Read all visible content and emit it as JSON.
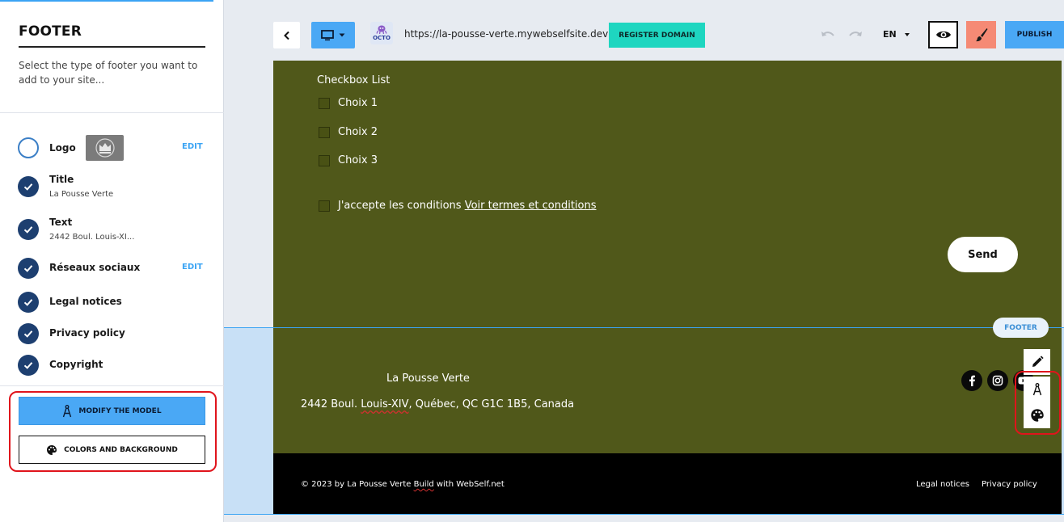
{
  "panel": {
    "title": "FOOTER",
    "description": "Select the type of footer you want to add to your site...",
    "options": [
      {
        "label": "Logo",
        "sub": "",
        "checked": false,
        "edit": "EDIT"
      },
      {
        "label": "Title",
        "sub": "La Pousse Verte",
        "checked": true,
        "edit": ""
      },
      {
        "label": "Text",
        "sub": "2442 Boul. Louis-XI...",
        "checked": true,
        "edit": ""
      },
      {
        "label": "Réseaux sociaux",
        "sub": "",
        "checked": true,
        "edit": "EDIT"
      },
      {
        "label": "Legal notices",
        "sub": "",
        "checked": true,
        "edit": ""
      },
      {
        "label": "Privacy policy",
        "sub": "",
        "checked": true,
        "edit": ""
      },
      {
        "label": "Copyright",
        "sub": "",
        "checked": true,
        "edit": ""
      }
    ],
    "modify_label": "MODIFY THE MODEL",
    "colors_label": "COLORS AND BACKGROUND"
  },
  "toolbar": {
    "octo_text": "OCTO",
    "url": "https://la-pousse-verte.mywebselfsite.dev",
    "register_label": "REGISTER DOMAIN",
    "language": "EN",
    "publish_label": "PUBLISH"
  },
  "form": {
    "checkbox_title": "Checkbox List",
    "choices": [
      "Choix 1",
      "Choix 2",
      "Choix 3"
    ],
    "terms_prefix": "J'accepte les conditions ",
    "terms_link": "Voir termes et conditions",
    "send_label": "Send"
  },
  "footer": {
    "badge": "FOOTER",
    "title": "La Pousse Verte",
    "address_start": "2442 Boul. ",
    "address_flag": "Louis-XIV",
    "address_end": ", Québec, QC G1C 1B5, Canada",
    "copyright_start": "© 2023 by La Pousse Verte ",
    "copyright_flag": "Build",
    "copyright_end": " with WebSelf.net",
    "legal_link": "Legal notices",
    "privacy_link": "Privacy policy"
  },
  "colors": {
    "accent_blue": "#4aa8f5",
    "register_teal": "#1ed6c0",
    "site_olive": "#50581a",
    "highlight_red": "#e0141c"
  }
}
